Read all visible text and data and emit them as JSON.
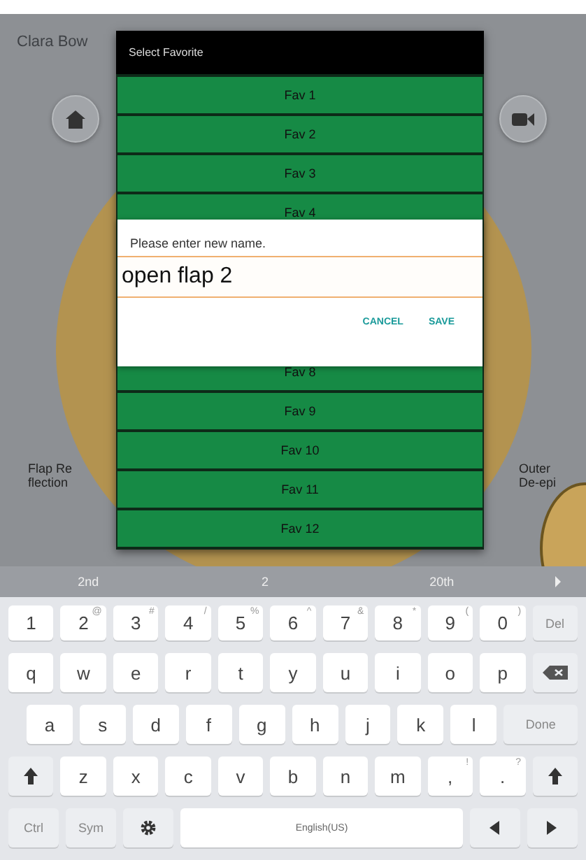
{
  "background": {
    "user_name": "Clara Bow",
    "left_label": "Flap Re flection",
    "right_label": "Outer De-epi"
  },
  "favorites_dialog": {
    "title": "Select Favorite",
    "items_above": [
      {
        "label": "Fav 1"
      },
      {
        "label": "Fav 2"
      },
      {
        "label": "Fav 3"
      },
      {
        "label": "Fav 4"
      }
    ],
    "items_below": [
      {
        "label": "Fav 8"
      },
      {
        "label": "Fav 9"
      },
      {
        "label": "Fav 10"
      },
      {
        "label": "Fav 11"
      },
      {
        "label": "Fav 12"
      }
    ]
  },
  "rename_dialog": {
    "prompt": "Please enter new name.",
    "value": "open flap 2",
    "buttons": [
      "CANCEL",
      "SAVE"
    ]
  },
  "keyboard": {
    "suggestions": [
      "2nd",
      "2",
      "20th"
    ],
    "rows": [
      [
        {
          "kind": "char",
          "label": "1"
        },
        {
          "kind": "char",
          "label": "2",
          "sup": "@"
        },
        {
          "kind": "char",
          "label": "3",
          "sup": "#"
        },
        {
          "kind": "char",
          "label": "4",
          "sup": "/"
        },
        {
          "kind": "char",
          "label": "5",
          "sup": "%"
        },
        {
          "kind": "char",
          "label": "6",
          "sup": "^"
        },
        {
          "kind": "char",
          "label": "7",
          "sup": "&"
        },
        {
          "kind": "char",
          "label": "8",
          "sup": "*"
        },
        {
          "kind": "char",
          "label": "9",
          "sup": "("
        },
        {
          "kind": "char",
          "label": "0",
          "sup": ")"
        },
        {
          "kind": "func",
          "label": "Del"
        }
      ],
      [
        {
          "kind": "char",
          "label": "q"
        },
        {
          "kind": "char",
          "label": "w"
        },
        {
          "kind": "char",
          "label": "e"
        },
        {
          "kind": "char",
          "label": "r"
        },
        {
          "kind": "char",
          "label": "t"
        },
        {
          "kind": "char",
          "label": "y"
        },
        {
          "kind": "char",
          "label": "u"
        },
        {
          "kind": "char",
          "label": "i"
        },
        {
          "kind": "char",
          "label": "o"
        },
        {
          "kind": "char",
          "label": "p"
        },
        {
          "kind": "backspace"
        }
      ],
      [
        {
          "kind": "char",
          "label": "a"
        },
        {
          "kind": "char",
          "label": "s"
        },
        {
          "kind": "char",
          "label": "d"
        },
        {
          "kind": "char",
          "label": "f"
        },
        {
          "kind": "char",
          "label": "g"
        },
        {
          "kind": "char",
          "label": "h"
        },
        {
          "kind": "char",
          "label": "j"
        },
        {
          "kind": "char",
          "label": "k"
        },
        {
          "kind": "char",
          "label": "l"
        },
        {
          "kind": "wide",
          "label": "Done"
        }
      ],
      [
        {
          "kind": "shift"
        },
        {
          "kind": "char",
          "label": "z"
        },
        {
          "kind": "char",
          "label": "x"
        },
        {
          "kind": "char",
          "label": "c"
        },
        {
          "kind": "char",
          "label": "v"
        },
        {
          "kind": "char",
          "label": "b"
        },
        {
          "kind": "char",
          "label": "n"
        },
        {
          "kind": "char",
          "label": "m"
        },
        {
          "kind": "char",
          "label": ",",
          "sup": "!"
        },
        {
          "kind": "char",
          "label": ".",
          "sup": "?"
        },
        {
          "kind": "shift"
        }
      ],
      [
        {
          "kind": "func",
          "label": "Ctrl"
        },
        {
          "kind": "func",
          "label": "Sym"
        },
        {
          "kind": "gear"
        },
        {
          "kind": "space",
          "label": "English(US)"
        },
        {
          "kind": "left"
        },
        {
          "kind": "right"
        }
      ]
    ]
  }
}
